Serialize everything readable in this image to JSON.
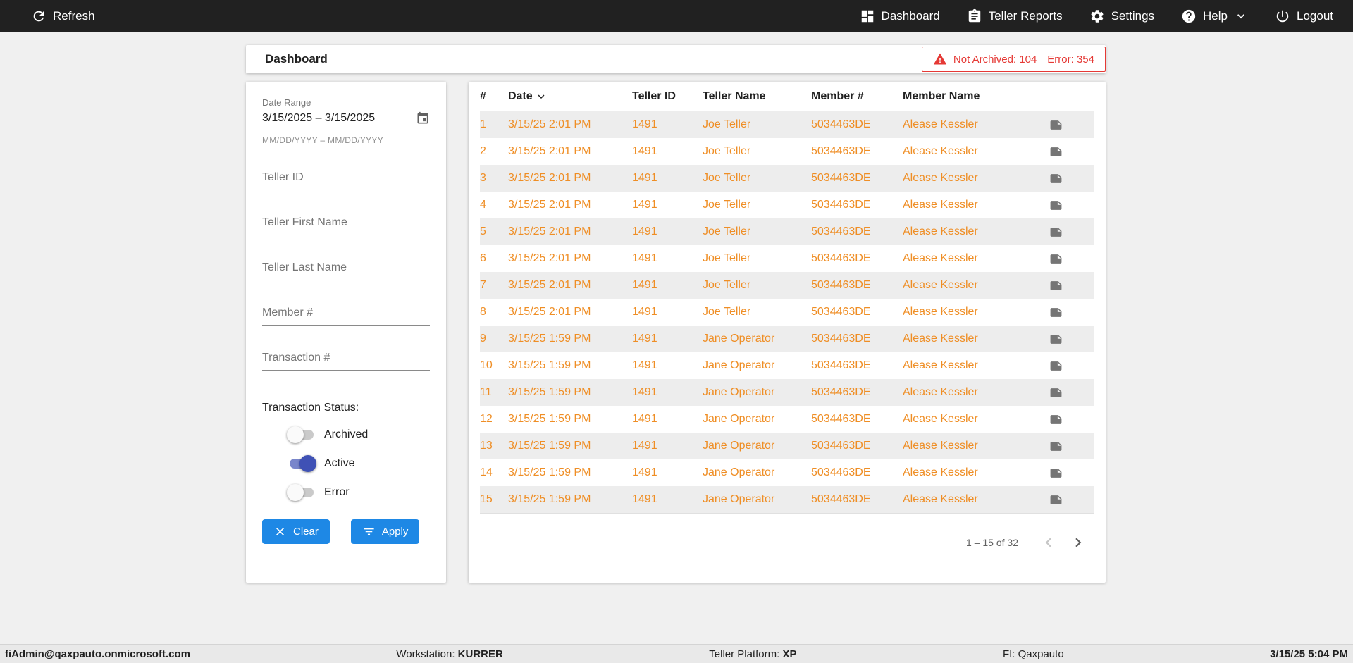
{
  "topbar": {
    "refresh_label": "Refresh",
    "nav": [
      {
        "label": "Dashboard"
      },
      {
        "label": "Teller Reports"
      },
      {
        "label": "Settings"
      },
      {
        "label": "Help"
      },
      {
        "label": "Logout"
      }
    ]
  },
  "header": {
    "title": "Dashboard",
    "alert": {
      "not_archived": "Not Archived: 104",
      "error": "Error: 354"
    }
  },
  "filters": {
    "date_range": {
      "label": "Date Range",
      "value": "3/15/2025 – 3/15/2025",
      "helper": "MM/DD/YYYY – MM/DD/YYYY"
    },
    "fields": [
      {
        "placeholder": "Teller ID"
      },
      {
        "placeholder": "Teller First Name"
      },
      {
        "placeholder": "Teller Last Name"
      },
      {
        "placeholder": "Member #"
      },
      {
        "placeholder": "Transaction #"
      }
    ],
    "status": {
      "label": "Transaction Status:",
      "toggles": [
        {
          "label": "Archived",
          "on": false
        },
        {
          "label": "Active",
          "on": true
        },
        {
          "label": "Error",
          "on": false
        }
      ]
    },
    "clear_label": "Clear",
    "apply_label": "Apply"
  },
  "table": {
    "columns": [
      "#",
      "Date",
      "Teller ID",
      "Teller Name",
      "Member #",
      "Member Name"
    ],
    "sorted_by": "Date",
    "rows": [
      {
        "num": "1",
        "date": "3/15/25 2:01 PM",
        "teller_id": "1491",
        "teller_name": "Joe Teller",
        "member_num": "5034463DE",
        "member_name": "Alease Kessler"
      },
      {
        "num": "2",
        "date": "3/15/25 2:01 PM",
        "teller_id": "1491",
        "teller_name": "Joe Teller",
        "member_num": "5034463DE",
        "member_name": "Alease Kessler"
      },
      {
        "num": "3",
        "date": "3/15/25 2:01 PM",
        "teller_id": "1491",
        "teller_name": "Joe Teller",
        "member_num": "5034463DE",
        "member_name": "Alease Kessler"
      },
      {
        "num": "4",
        "date": "3/15/25 2:01 PM",
        "teller_id": "1491",
        "teller_name": "Joe Teller",
        "member_num": "5034463DE",
        "member_name": "Alease Kessler"
      },
      {
        "num": "5",
        "date": "3/15/25 2:01 PM",
        "teller_id": "1491",
        "teller_name": "Joe Teller",
        "member_num": "5034463DE",
        "member_name": "Alease Kessler"
      },
      {
        "num": "6",
        "date": "3/15/25 2:01 PM",
        "teller_id": "1491",
        "teller_name": "Joe Teller",
        "member_num": "5034463DE",
        "member_name": "Alease Kessler"
      },
      {
        "num": "7",
        "date": "3/15/25 2:01 PM",
        "teller_id": "1491",
        "teller_name": "Joe Teller",
        "member_num": "5034463DE",
        "member_name": "Alease Kessler"
      },
      {
        "num": "8",
        "date": "3/15/25 2:01 PM",
        "teller_id": "1491",
        "teller_name": "Joe Teller",
        "member_num": "5034463DE",
        "member_name": "Alease Kessler"
      },
      {
        "num": "9",
        "date": "3/15/25 1:59 PM",
        "teller_id": "1491",
        "teller_name": "Jane Operator",
        "member_num": "5034463DE",
        "member_name": "Alease Kessler"
      },
      {
        "num": "10",
        "date": "3/15/25 1:59 PM",
        "teller_id": "1491",
        "teller_name": "Jane Operator",
        "member_num": "5034463DE",
        "member_name": "Alease Kessler"
      },
      {
        "num": "11",
        "date": "3/15/25 1:59 PM",
        "teller_id": "1491",
        "teller_name": "Jane Operator",
        "member_num": "5034463DE",
        "member_name": "Alease Kessler"
      },
      {
        "num": "12",
        "date": "3/15/25 1:59 PM",
        "teller_id": "1491",
        "teller_name": "Jane Operator",
        "member_num": "5034463DE",
        "member_name": "Alease Kessler"
      },
      {
        "num": "13",
        "date": "3/15/25 1:59 PM",
        "teller_id": "1491",
        "teller_name": "Jane Operator",
        "member_num": "5034463DE",
        "member_name": "Alease Kessler"
      },
      {
        "num": "14",
        "date": "3/15/25 1:59 PM",
        "teller_id": "1491",
        "teller_name": "Jane Operator",
        "member_num": "5034463DE",
        "member_name": "Alease Kessler"
      },
      {
        "num": "15",
        "date": "3/15/25 1:59 PM",
        "teller_id": "1491",
        "teller_name": "Jane Operator",
        "member_num": "5034463DE",
        "member_name": "Alease Kessler"
      }
    ],
    "pagination": {
      "range_label": "1 – 15 of 32"
    }
  },
  "statusbar": {
    "user": "fiAdmin@qaxpauto.onmicrosoft.com",
    "workstation_label": "Workstation: ",
    "workstation_value": "KURRER",
    "platform_label": "Teller Platform: ",
    "platform_value": "XP",
    "fi_label": "FI: ",
    "fi_value": "Qaxpauto",
    "datetime": "3/15/25 5:04 PM"
  },
  "colors": {
    "accent_orange": "#ef8e25",
    "alert_red": "#e53935",
    "button_blue": "#1e88e5",
    "toggle_blue": "#3f51b5",
    "topbar_bg": "#212121"
  }
}
